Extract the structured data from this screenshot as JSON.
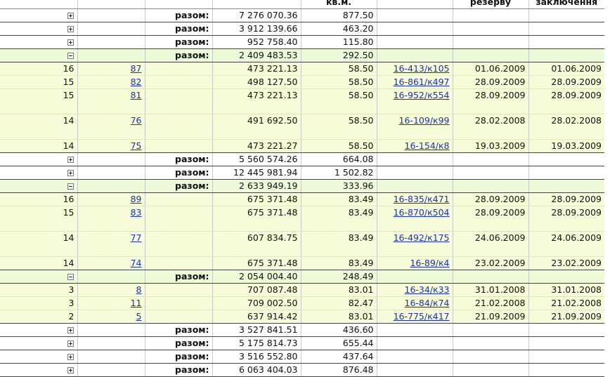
{
  "header": [
    "",
    "",
    "",
    "",
    "кв.м.",
    "",
    "резерву",
    "заключення"
  ],
  "groups": [
    {
      "expanded": false,
      "label": "разом:",
      "total": "7 276 070.36",
      "area": "877.50",
      "rows": []
    },
    {
      "expanded": false,
      "label": "разом:",
      "total": "3 912 139.66",
      "area": "463.20",
      "rows": []
    },
    {
      "expanded": false,
      "label": "разом:",
      "total": "952 758.40",
      "area": "115.80",
      "rows": []
    },
    {
      "expanded": true,
      "label": "разом:",
      "total": "2 409 483.53",
      "area": "292.50",
      "rows": [
        {
          "floor": "16",
          "num": "87",
          "sum": "473 221.13",
          "area": "58.50",
          "contract": "16-413/к105",
          "reserve": "01.06.2009",
          "concl": "01.06.2009",
          "tall": false
        },
        {
          "floor": "15",
          "num": "82",
          "sum": "498 127.50",
          "area": "58.50",
          "contract": "16-861/к497",
          "reserve": "28.09.2009",
          "concl": "28.09.2009",
          "tall": false
        },
        {
          "floor": "15",
          "num": "81",
          "sum": "473 221.13",
          "area": "58.50",
          "contract": "16-952/к554",
          "reserve": "28.09.2009",
          "concl": "28.09.2009",
          "tall": true
        },
        {
          "floor": "14",
          "num": "76",
          "sum": "491 692.50",
          "area": "58.50",
          "contract": "16-109/к99",
          "reserve": "28.02.2008",
          "concl": "28.02.2008",
          "tall": true
        },
        {
          "floor": "14",
          "num": "75",
          "sum": "473 221.27",
          "area": "58.50",
          "contract": "16-154/к8",
          "reserve": "19.03.2009",
          "concl": "19.03.2009",
          "tall": false
        }
      ]
    },
    {
      "expanded": false,
      "label": "разом:",
      "total": "5 560 574.26",
      "area": "664.08",
      "rows": []
    },
    {
      "expanded": false,
      "label": "разом:",
      "total": "12 445 981.94",
      "area": "1 502.82",
      "rows": []
    },
    {
      "expanded": true,
      "label": "разом:",
      "total": "2 633 949.19",
      "area": "333.96",
      "rows": [
        {
          "floor": "16",
          "num": "89",
          "sum": "675 371.48",
          "area": "83.49",
          "contract": "16-835/к471",
          "reserve": "28.09.2009",
          "concl": "28.09.2009",
          "tall": false
        },
        {
          "floor": "15",
          "num": "83",
          "sum": "675 371.48",
          "area": "83.49",
          "contract": "16-870/к504",
          "reserve": "28.09.2009",
          "concl": "28.09.2009",
          "tall": true
        },
        {
          "floor": "14",
          "num": "77",
          "sum": "607 834.75",
          "area": "83.49",
          "contract": "16-492/к175",
          "reserve": "24.06.2009",
          "concl": "24.06.2009",
          "tall": true
        },
        {
          "floor": "14",
          "num": "74",
          "sum": "675 371.48",
          "area": "83.49",
          "contract": "16-89/к4",
          "reserve": "23.02.2009",
          "concl": "23.02.2009",
          "tall": false
        }
      ]
    },
    {
      "expanded": true,
      "label": "разом:",
      "total": "2 054 004.40",
      "area": "248.49",
      "rows": [
        {
          "floor": "3",
          "num": "8",
          "sum": "707 087.48",
          "area": "83.01",
          "contract": "16-34/к33",
          "reserve": "31.01.2008",
          "concl": "31.01.2008",
          "tall": false
        },
        {
          "floor": "3",
          "num": "11",
          "sum": "709 002.50",
          "area": "82.47",
          "contract": "16-84/к74",
          "reserve": "21.02.2008",
          "concl": "21.02.2008",
          "tall": false
        },
        {
          "floor": "2",
          "num": "5",
          "sum": "637 914.42",
          "area": "83.01",
          "contract": "16-775/к417",
          "reserve": "21.09.2009",
          "concl": "21.09.2009",
          "tall": false
        }
      ]
    },
    {
      "expanded": false,
      "label": "разом:",
      "total": "3 527 841.51",
      "area": "436.60",
      "rows": []
    },
    {
      "expanded": false,
      "label": "разом:",
      "total": "5 175 814.73",
      "area": "655.44",
      "rows": []
    },
    {
      "expanded": false,
      "label": "разом:",
      "total": "3 516 552.80",
      "area": "437.64",
      "rows": []
    },
    {
      "expanded": false,
      "label": "разом:",
      "total": "6 063 404.03",
      "area": "876.48",
      "rows": []
    }
  ]
}
